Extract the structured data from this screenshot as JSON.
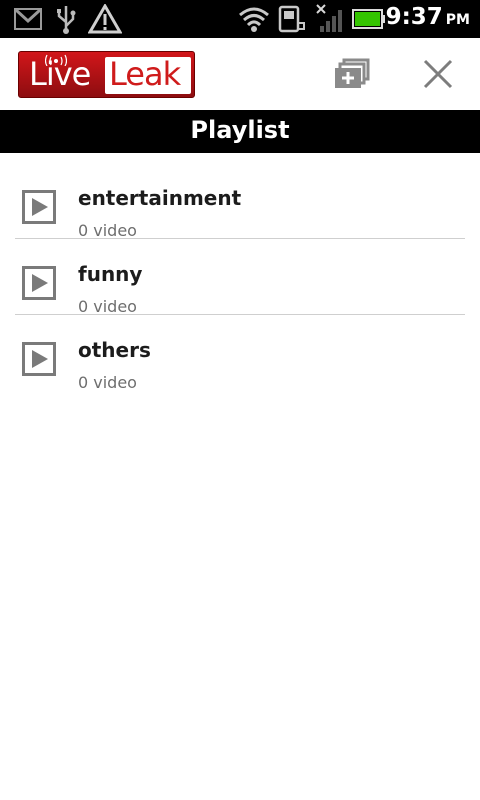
{
  "status_bar": {
    "time": "9:37",
    "ampm": "PM",
    "icons": [
      "gmail-icon",
      "usb-icon",
      "warning-icon",
      "wifi-icon",
      "sd-card-icon",
      "no-signal-icon",
      "battery-icon"
    ]
  },
  "header": {
    "logo_live": "Live",
    "logo_leak": "Leak",
    "actions": [
      "add-playlist-icon",
      "close-icon"
    ]
  },
  "title": "Playlist",
  "playlists": [
    {
      "name": "entertainment",
      "count": "0 video"
    },
    {
      "name": "funny",
      "count": "0 video"
    },
    {
      "name": "others",
      "count": "0 video"
    }
  ],
  "colors": {
    "brand_red": "#cf1b1b",
    "bar_black": "#000000"
  }
}
